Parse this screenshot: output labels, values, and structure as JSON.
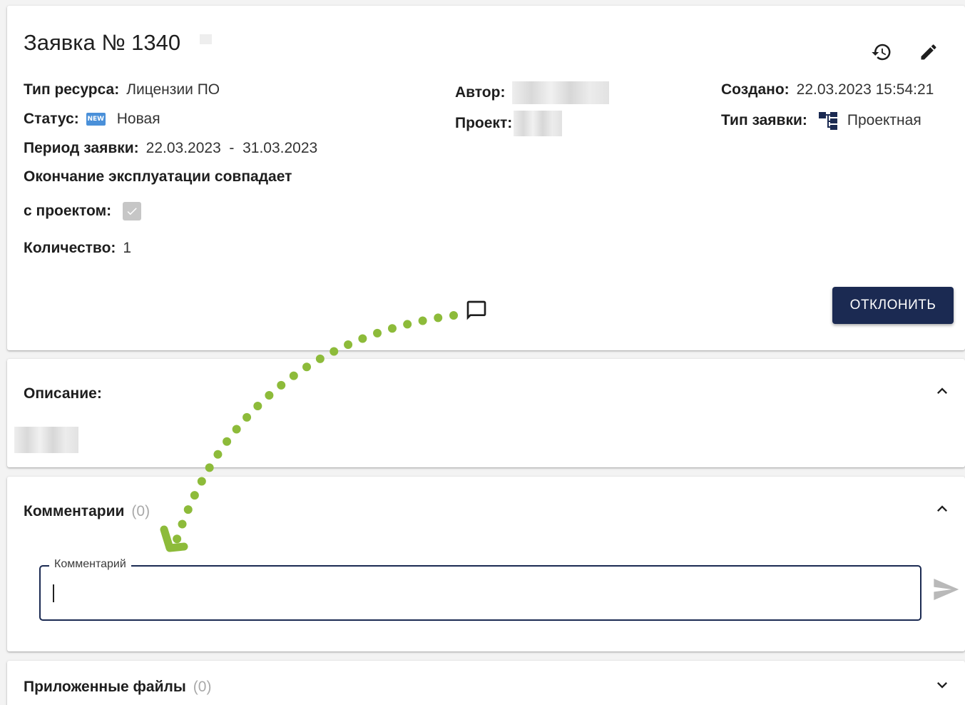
{
  "request": {
    "title": "Заявка № 1340",
    "resource_type_label": "Тип ресурса:",
    "resource_type_value": "Лицензии ПО",
    "status_label": "Статус:",
    "status_badge": "NEW",
    "status_value": "Новая",
    "period_label": "Период заявки:",
    "period_value": "22.03.2023  -  31.03.2023",
    "end_coincides_line1": "Окончание эксплуатации совпадает",
    "end_coincides_line2": "с проектом:",
    "end_coincides_checked": true,
    "quantity_label": "Количество:",
    "quantity_value": "1",
    "author_label": "Автор:",
    "project_label": "Проект:",
    "created_label": "Создано:",
    "created_value": "22.03.2023 15:54:21",
    "request_type_label": "Тип заявки:",
    "request_type_value": "Проектная",
    "reject_button": "ОТКЛОНИТЬ",
    "icons": [
      "history-icon",
      "edit-icon",
      "comment-icon",
      "hierarchy-icon"
    ]
  },
  "description": {
    "title": "Описание:"
  },
  "comments": {
    "title": "Комментарии",
    "count": "(0)",
    "field_label": "Комментарий",
    "value": ""
  },
  "files": {
    "title": "Приложенные файлы",
    "count": "(0)"
  },
  "colors": {
    "primary": "#1b2a52",
    "badge_new": "#4a90d9",
    "annotation_arrow": "#8dbb3a",
    "muted_count": "#a9a9a9"
  }
}
